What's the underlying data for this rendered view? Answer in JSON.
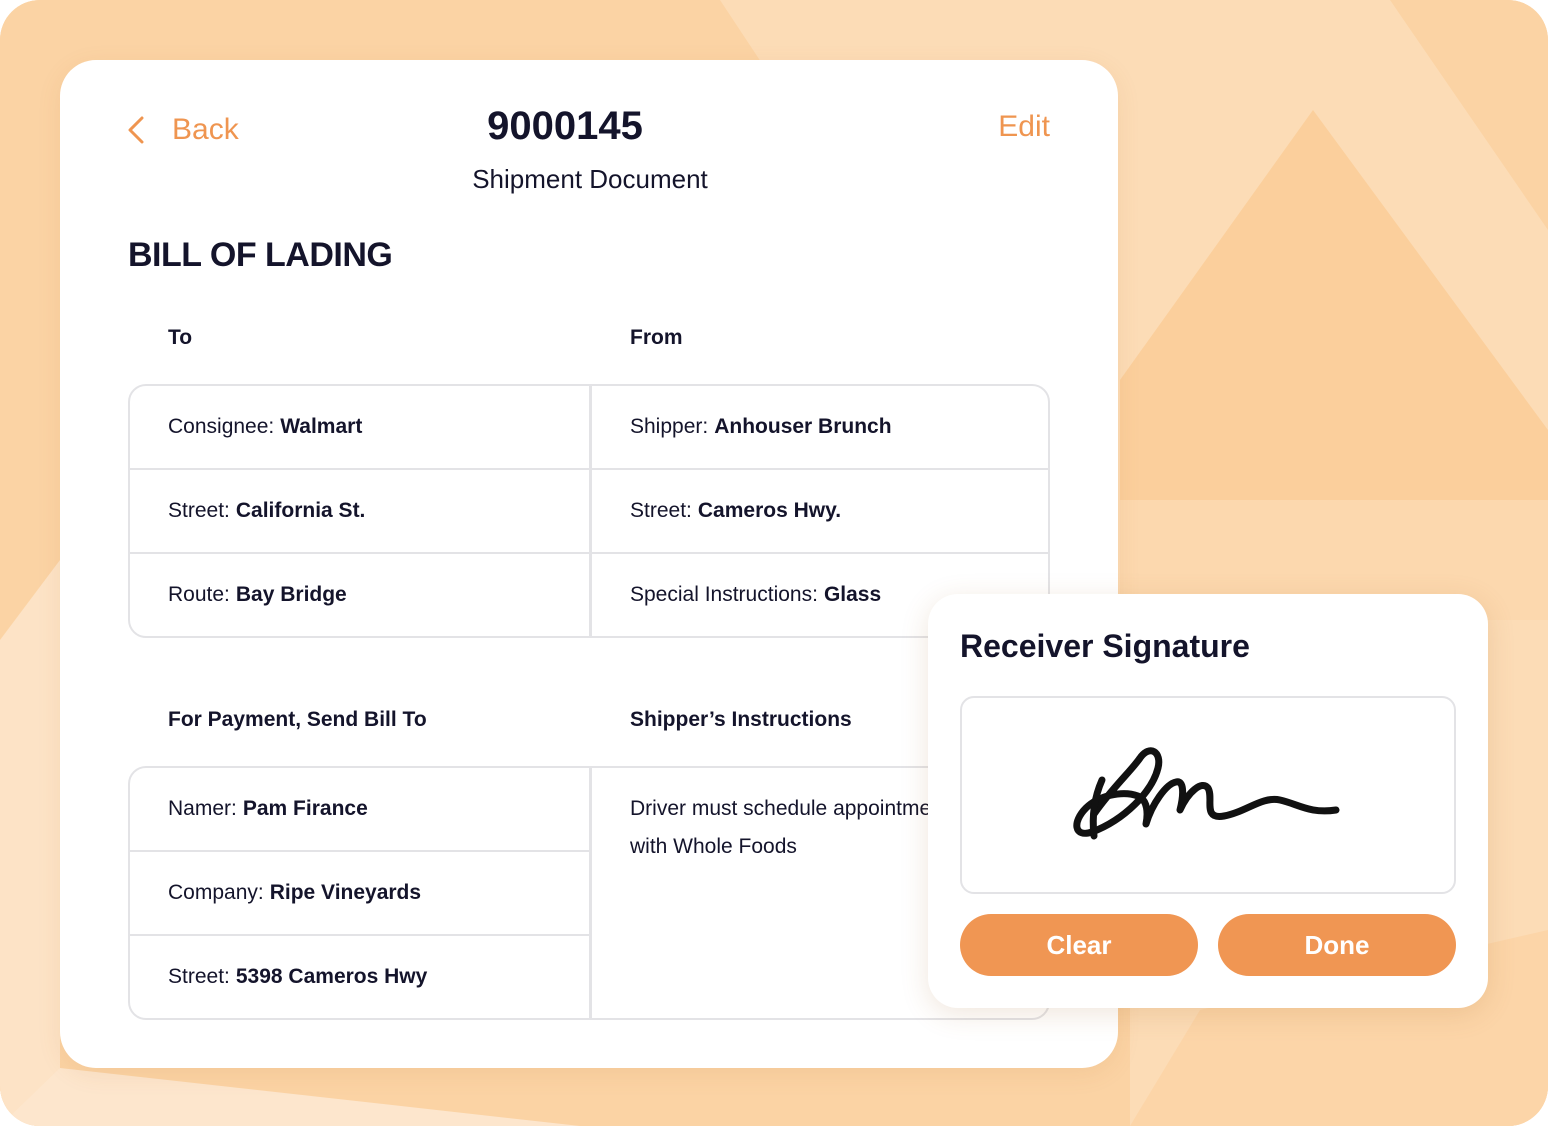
{
  "header": {
    "back_label": "Back",
    "document_number": "9000145",
    "document_type": "Shipment Document",
    "edit_label": "Edit"
  },
  "document_title": "BILL OF LADING",
  "to_from": {
    "to_heading": "To",
    "from_heading": "From",
    "rows": [
      {
        "left_label": "Consignee:",
        "left_value": "Walmart",
        "right_label": "Shipper:",
        "right_value": "Anhouser Brunch"
      },
      {
        "left_label": "Street:",
        "left_value": "California St.",
        "right_label": "Street:",
        "right_value": "Cameros Hwy."
      },
      {
        "left_label": "Route:",
        "left_value": "Bay Bridge",
        "right_label": "Special Instructions:",
        "right_value": "Glass"
      }
    ]
  },
  "payment": {
    "bill_to_heading": "For Payment, Send Bill To",
    "instructions_heading": "Shipper’s Instructions",
    "rows": [
      {
        "label": "Namer:",
        "value": "Pam Firance"
      },
      {
        "label": "Company:",
        "value": "Ripe Vineyards"
      },
      {
        "label": "Street:",
        "value": "5398 Cameros Hwy"
      }
    ],
    "instructions_line1": "Driver must schedule appointment",
    "instructions_line2": "with Whole Foods"
  },
  "signature": {
    "title": "Receiver Signature",
    "clear_label": "Clear",
    "done_label": "Done"
  },
  "colors": {
    "accent": "#f09653",
    "background": "#fbd3a4",
    "text": "#14142b",
    "border": "#e3e3e6"
  }
}
